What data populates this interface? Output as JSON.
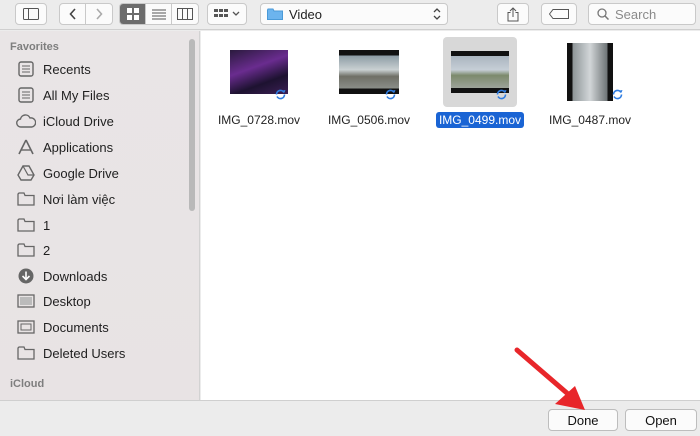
{
  "toolbar": {
    "location": "Video",
    "search_placeholder": "Search"
  },
  "sidebar": {
    "favorites_header": "Favorites",
    "items": [
      {
        "label": "Recents",
        "icon": "recents-icon"
      },
      {
        "label": "All My Files",
        "icon": "all-files-icon"
      },
      {
        "label": "iCloud Drive",
        "icon": "cloud-icon"
      },
      {
        "label": "Applications",
        "icon": "applications-icon"
      },
      {
        "label": "Google Drive",
        "icon": "google-drive-icon"
      },
      {
        "label": "Nơi làm việc",
        "icon": "folder-icon"
      },
      {
        "label": "1",
        "icon": "folder-icon"
      },
      {
        "label": "2",
        "icon": "folder-icon"
      },
      {
        "label": "Downloads",
        "icon": "download-icon"
      },
      {
        "label": "Desktop",
        "icon": "desktop-icon"
      },
      {
        "label": "Documents",
        "icon": "documents-icon"
      },
      {
        "label": "Deleted Users",
        "icon": "folder-icon"
      }
    ],
    "icloud_header": "iCloud"
  },
  "files": [
    {
      "name": "IMG_0728.mov",
      "selected": false
    },
    {
      "name": "IMG_0506.mov",
      "selected": false
    },
    {
      "name": "IMG_0499.mov",
      "selected": true
    },
    {
      "name": "IMG_0487.mov",
      "selected": false
    }
  ],
  "buttons": {
    "done": "Done",
    "open": "Open"
  },
  "colors": {
    "selection": "#1a64d4",
    "annotation_arrow": "#e8262a"
  }
}
